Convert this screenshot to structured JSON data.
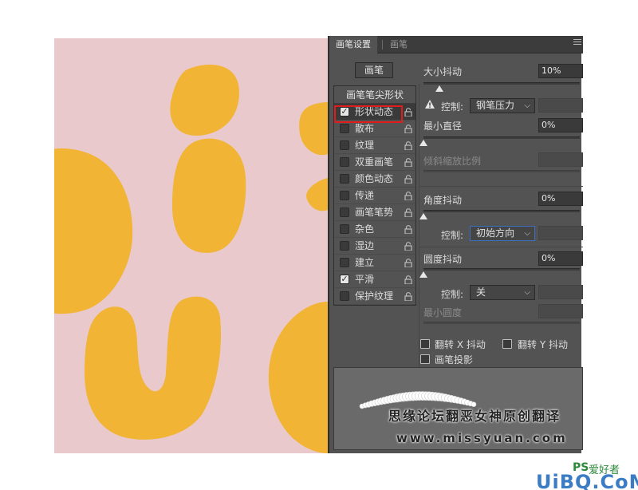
{
  "panel": {
    "tabs": [
      "画笔设置",
      "画笔"
    ],
    "brush_button": "画笔",
    "tip_shape": "画笔笔尖形状",
    "options": [
      {
        "label": "形状动态",
        "checked": true
      },
      {
        "label": "散布",
        "checked": false
      },
      {
        "label": "纹理",
        "checked": false
      },
      {
        "label": "双重画笔",
        "checked": false
      },
      {
        "label": "颜色动态",
        "checked": false
      },
      {
        "label": "传递",
        "checked": false
      },
      {
        "label": "画笔笔势",
        "checked": false
      },
      {
        "label": "杂色",
        "checked": false
      },
      {
        "label": "湿边",
        "checked": false
      },
      {
        "label": "建立",
        "checked": false
      },
      {
        "label": "平滑",
        "checked": true
      },
      {
        "label": "保护纹理",
        "checked": false
      }
    ]
  },
  "settings": {
    "size_jitter": {
      "label": "大小抖动",
      "value": "10%",
      "level": 0.1
    },
    "size_control": {
      "label": "控制:",
      "value": "钢笔压力"
    },
    "min_diameter": {
      "label": "最小直径",
      "value": "0%",
      "level": 0
    },
    "tilt_scale": {
      "label": "倾斜缩放比例"
    },
    "angle_jitter": {
      "label": "角度抖动",
      "value": "0%",
      "level": 0
    },
    "angle_control": {
      "label": "控制:",
      "value": "初始方向"
    },
    "roundness_jitter": {
      "label": "圆度抖动",
      "value": "0%",
      "level": 0
    },
    "roundness_control": {
      "label": "控制:",
      "value": "关"
    },
    "min_roundness": {
      "label": "最小圆度"
    },
    "flip_x": {
      "label": "翻转 X 抖动",
      "checked": false
    },
    "flip_y": {
      "label": "翻转 Y 抖动",
      "checked": false
    },
    "brush_projection": {
      "label": "画笔投影",
      "checked": false
    }
  },
  "watermark": {
    "text": "思缘论坛翻恶女神原创翻译",
    "url": "www.missyuan.com",
    "logo_ps": "PS",
    "logo_ps_cn": "爱好者",
    "logo_uibq": "UiBQ.CoM"
  },
  "colors": {
    "canvas_bg": "#e9c9cc",
    "letter_fill": "#f1b434",
    "panel_bg": "#535353",
    "highlight": "#e01c1c"
  }
}
